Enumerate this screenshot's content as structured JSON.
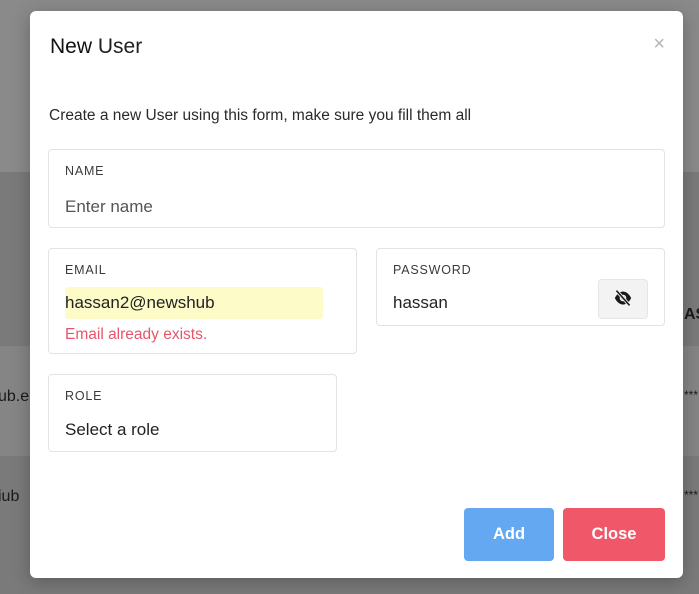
{
  "background": {
    "row1": "ub.e",
    "row2": "iub",
    "col_header_fragment": "AS",
    "stars1": "***",
    "stars2": "***"
  },
  "modal": {
    "title_bold": "New",
    "title_rest": " User",
    "close_symbol": "×",
    "description": "Create a new User using this form, make sure you fill them all"
  },
  "form": {
    "name": {
      "label": "NAME",
      "placeholder": "Enter name",
      "value": ""
    },
    "email": {
      "label": "EMAIL",
      "value": "hassan2@newshub",
      "error": "Email already exists."
    },
    "password": {
      "label": "PASSWORD",
      "value": "hassan",
      "toggle_icon": "eye-slash-icon"
    },
    "role": {
      "label": "ROLE",
      "selected": "Select a role"
    }
  },
  "buttons": {
    "add": "Add",
    "close": "Close"
  },
  "colors": {
    "add_button": "#63a8f0",
    "close_button": "#f0586a",
    "error_text": "#e5566b",
    "autofill_bg": "#fdfbc8"
  }
}
